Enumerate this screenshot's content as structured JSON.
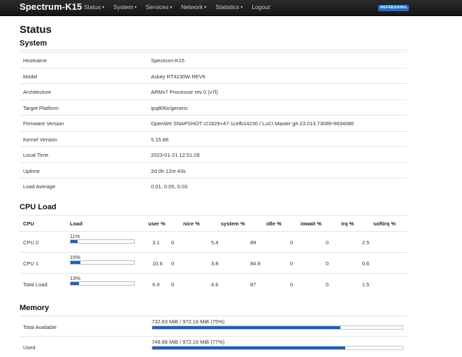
{
  "navbar": {
    "brand": "Spectrum-K15",
    "menu": [
      {
        "label": "Status",
        "caret": "▾"
      },
      {
        "label": "System",
        "caret": "▾"
      },
      {
        "label": "Services",
        "caret": "▾"
      },
      {
        "label": "Network",
        "caret": "▾"
      },
      {
        "label": "Statistics",
        "caret": "▾"
      },
      {
        "label": "Logout",
        "caret": ""
      }
    ],
    "badge": "REFRESHING"
  },
  "page": {
    "title": "Status"
  },
  "system": {
    "heading": "System",
    "rows": [
      {
        "key": "Hostname",
        "value": "Spectrum-K15"
      },
      {
        "key": "Model",
        "value": "Askey RT4230W REV6"
      },
      {
        "key": "Architecture",
        "value": "ARMv7 Processor rev 0 (v7l)"
      },
      {
        "key": "Target Platform",
        "value": "ipq806x/generic"
      },
      {
        "key": "Firmware Version",
        "value": "OpenWrt SNAPSHOT r21829+47-1cefb14230 / LuCI Master git-23.013.73089-9634086"
      },
      {
        "key": "Kernel Version",
        "value": "5.15.88"
      },
      {
        "key": "Local Time",
        "value": "2023-01-21 12:51:28"
      },
      {
        "key": "Uptime",
        "value": "2d 0h 12m 43s"
      },
      {
        "key": "Load Average",
        "value": "0.01, 0.05, 0.03"
      }
    ]
  },
  "cpu": {
    "heading": "CPU Load",
    "columns": [
      "CPU",
      "Load",
      "user %",
      "nice %",
      "system %",
      "idle %",
      "iowait %",
      "irq %",
      "softirq %"
    ],
    "rows": [
      {
        "name": "CPU 0",
        "load": "11%",
        "load_fraction": 0.11,
        "user": "3.1",
        "nice": "0",
        "system": "5.4",
        "idle": "89",
        "iowait": "0",
        "irq": "0",
        "softirq": "2.5"
      },
      {
        "name": "CPU 1",
        "load": "15%",
        "load_fraction": 0.15,
        "user": "10.6",
        "nice": "0",
        "system": "3.8",
        "idle": "84.9",
        "iowait": "0",
        "irq": "0",
        "softirq": "0.6"
      },
      {
        "name": "Total Load",
        "load": "13%",
        "load_fraction": 0.13,
        "user": "6.9",
        "nice": "0",
        "system": "4.6",
        "idle": "87",
        "iowait": "0",
        "irq": "0",
        "softirq": "1.5"
      }
    ]
  },
  "memory": {
    "heading": "Memory",
    "rows": [
      {
        "key": "Total Available",
        "value": "732.63 MiB / 972.16 MiB (75%)",
        "fraction": 0.75
      },
      {
        "key": "Used",
        "value": "749.88 MiB / 972.16 MiB (77%)",
        "fraction": 0.77
      }
    ]
  },
  "colors": {
    "accent": "#1f5fbf",
    "badge": "#1f6fc2",
    "navbar": "#1e1e1e"
  }
}
